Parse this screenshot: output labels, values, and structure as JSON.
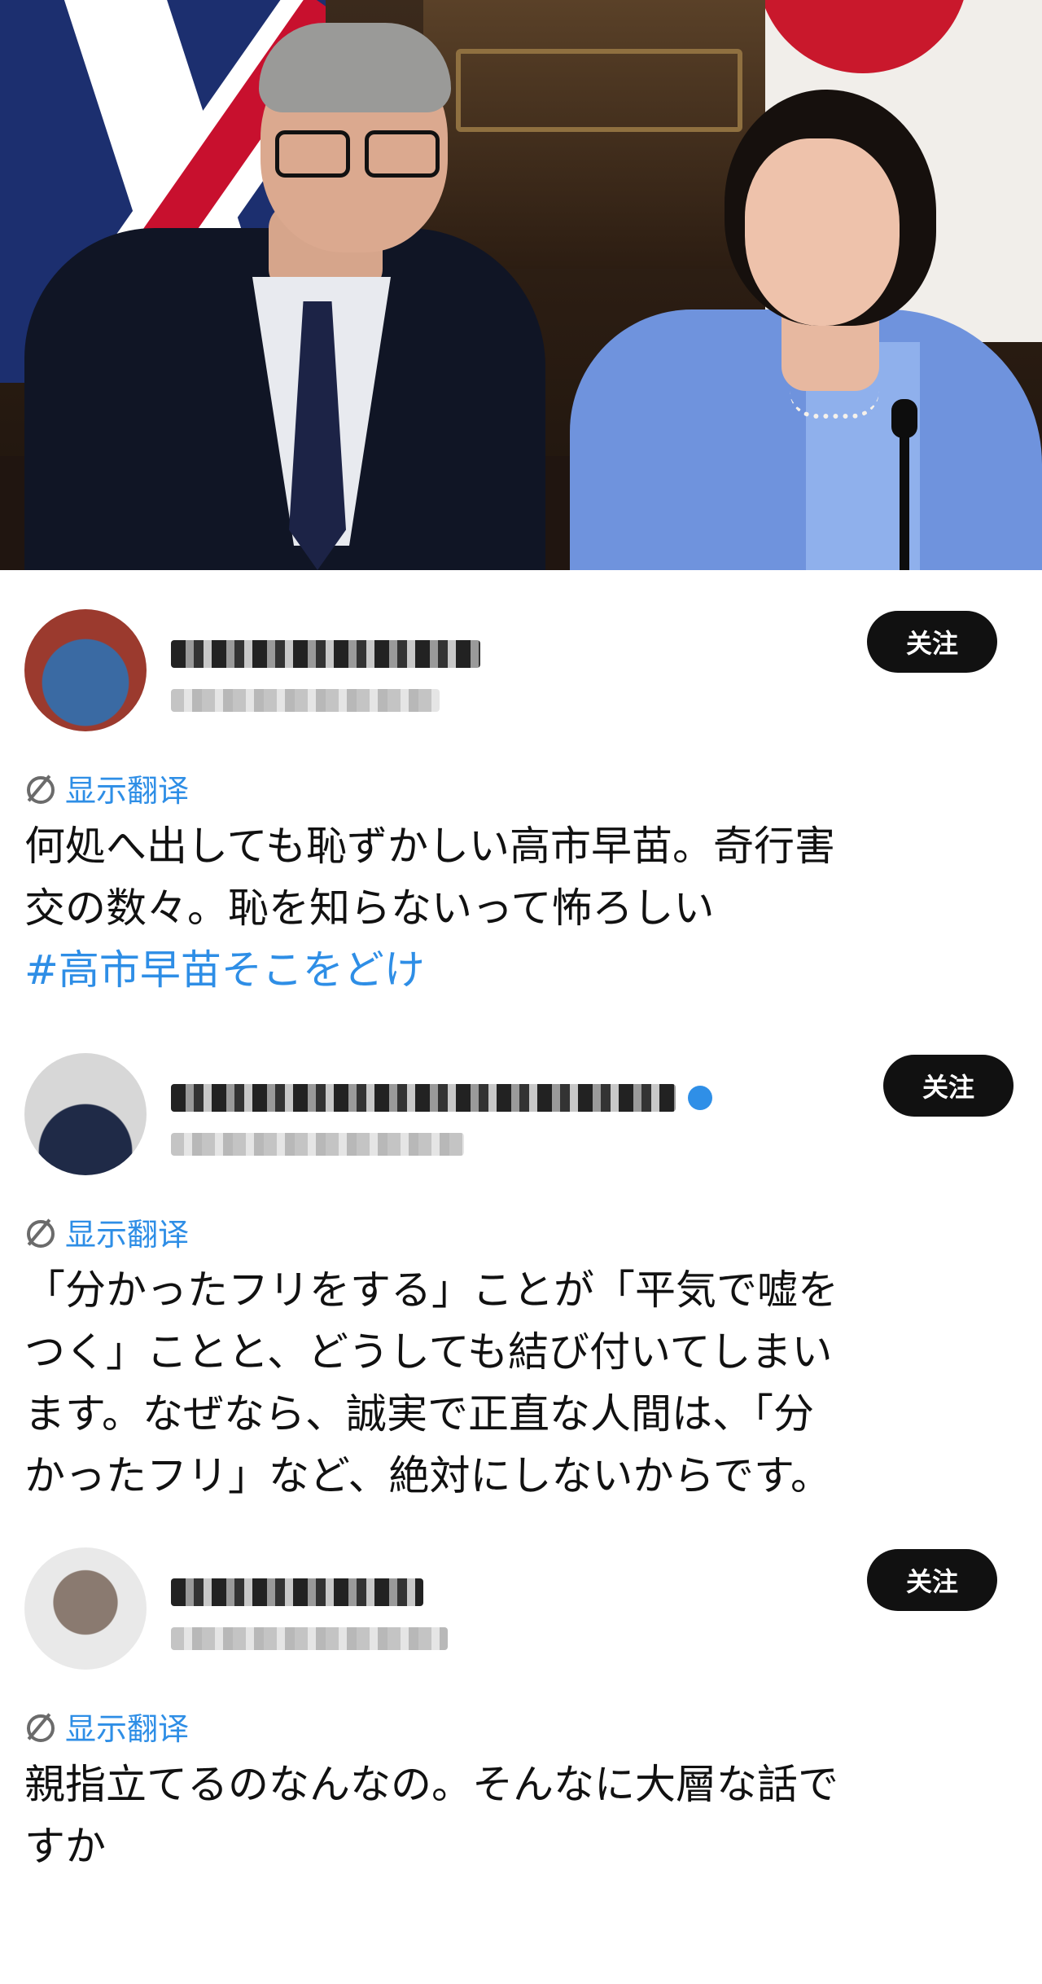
{
  "comments": [
    {
      "follow_label": "关注",
      "translate_label": "显示翻译",
      "text": "何処へ出しても恥ずかしい高市早苗。奇行害\n交の数々。恥を知らないって怖ろしい",
      "hashtag": "#高市早苗そこをどけ"
    },
    {
      "follow_label": "关注",
      "translate_label": "显示翻译",
      "text": "「分かったフリをする」ことが「平気で嘘を\nつく」ことと、どうしても結び付いてしまい\nます。なぜなら、誠実で正直な人間は、「分\nかったフリ」など、絶対にしないからです。"
    },
    {
      "follow_label": "关注",
      "translate_label": "显示翻译",
      "text": "親指立てるのなんなの。そんなに大層な話で\nすか"
    }
  ],
  "icons": {
    "translate": "translate-icon",
    "verified": "verified-badge-icon"
  },
  "colors": {
    "link_blue": "#2e8ee6",
    "button_bg": "#111111",
    "button_text": "#ffffff"
  }
}
